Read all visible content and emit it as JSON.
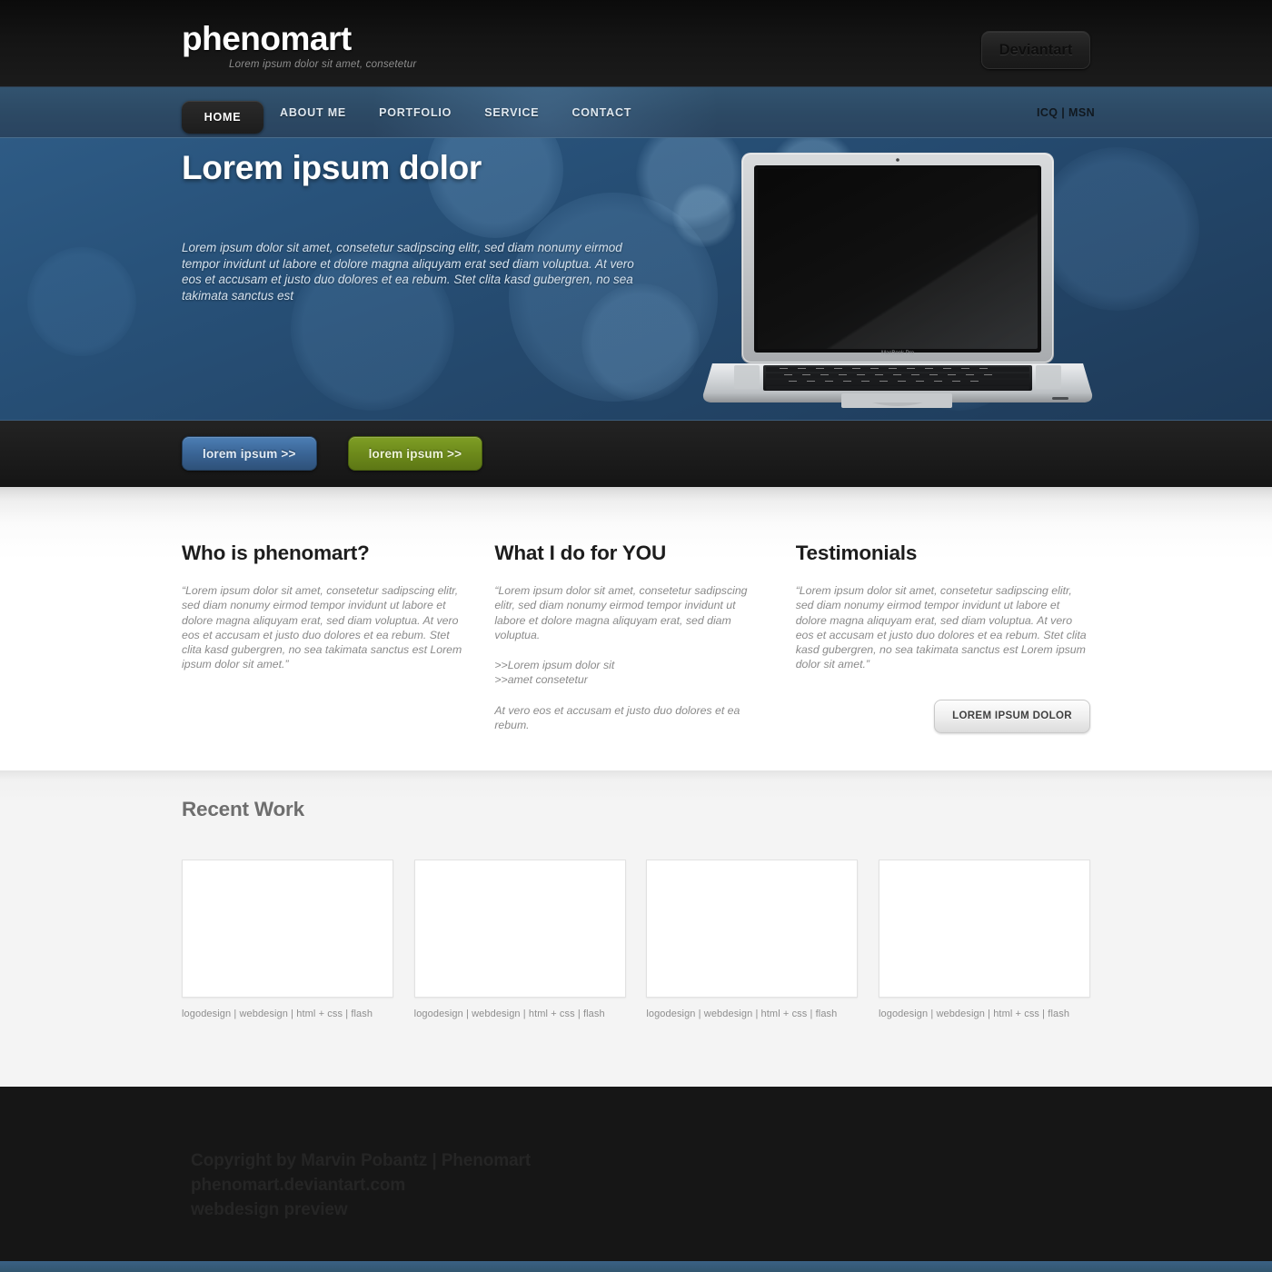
{
  "header": {
    "brand_name": "phenomart",
    "brand_tagline": "Lorem ipsum dolor sit amet, consetetur",
    "deviantart_label": "Deviantart"
  },
  "nav": {
    "items": [
      {
        "label": "HOME",
        "active": true
      },
      {
        "label": "ABOUT ME",
        "active": false
      },
      {
        "label": "PORTFOLIO",
        "active": false
      },
      {
        "label": "SERVICE",
        "active": false
      },
      {
        "label": "CONTACT",
        "active": false
      }
    ],
    "messenger": "ICQ | MSN"
  },
  "hero": {
    "title": "Lorem ipsum dolor",
    "paragraph": "Lorem ipsum dolor sit amet, consetetur sadipscing elitr, sed diam nonumy eirmod tempor invidunt ut labore et dolore magna aliquyam erat sed diam voluptua. At vero eos et accusam et justo duo dolores et ea rebum. Stet clita kasd gubergren, no sea takimata sanctus est",
    "laptop_label": "MacBook Pro",
    "buttons": [
      {
        "label": "lorem ipsum >>",
        "color": "#3a6596"
      },
      {
        "label": "lorem ipsum >>",
        "color": "#6d8a1b"
      }
    ]
  },
  "content": {
    "columns": [
      {
        "title": "Who is phenomart?",
        "paragraphs": [
          "“Lorem ipsum dolor sit amet, consetetur sadipscing elitr, sed diam nonumy eirmod tempor invidunt ut labore et dolore magna aliquyam erat, sed diam voluptua. At vero eos et accusam et justo duo dolores et ea rebum. Stet clita kasd gubergren, no sea takimata sanctus est Lorem ipsum dolor sit amet.”"
        ]
      },
      {
        "title": "What I do for YOU",
        "paragraphs": [
          "“Lorem ipsum dolor sit amet, consetetur sadipscing elitr, sed diam nonumy eirmod tempor invidunt ut labore et dolore magna aliquyam erat, sed diam voluptua.",
          ">>Lorem ipsum dolor sit\n>>amet consetetur",
          "At vero eos et accusam et justo duo dolores et ea rebum."
        ]
      },
      {
        "title": "Testimonials",
        "paragraphs": [
          "“Lorem ipsum dolor sit amet, consetetur sadipscing elitr, sed diam nonumy eirmod tempor invidunt ut labore et dolore magna aliquyam erat, sed diam voluptua. At vero eos et accusam et justo duo dolores et ea rebum. Stet clita kasd gubergren, no sea takimata sanctus est Lorem ipsum dolor sit amet.”"
        ],
        "button_label": "LOREM IPSUM DOLOR"
      }
    ]
  },
  "work": {
    "title": "Recent Work",
    "items": [
      {
        "caption": "logodesign | webdesign | html + css | flash"
      },
      {
        "caption": "logodesign | webdesign | html + css | flash"
      },
      {
        "caption": "logodesign | webdesign | html + css | flash"
      },
      {
        "caption": "logodesign | webdesign | html + css | flash"
      }
    ]
  },
  "footer": {
    "lines": [
      "Copyright by Marvin Pobantz | Phenomart",
      "phenomart.deviantart.com",
      "webdesign preview"
    ]
  },
  "colors": {
    "accent_blue": "#3a6596",
    "accent_green": "#6d8a1b",
    "nav_blue": "#2c4964",
    "dark": "#161616"
  }
}
